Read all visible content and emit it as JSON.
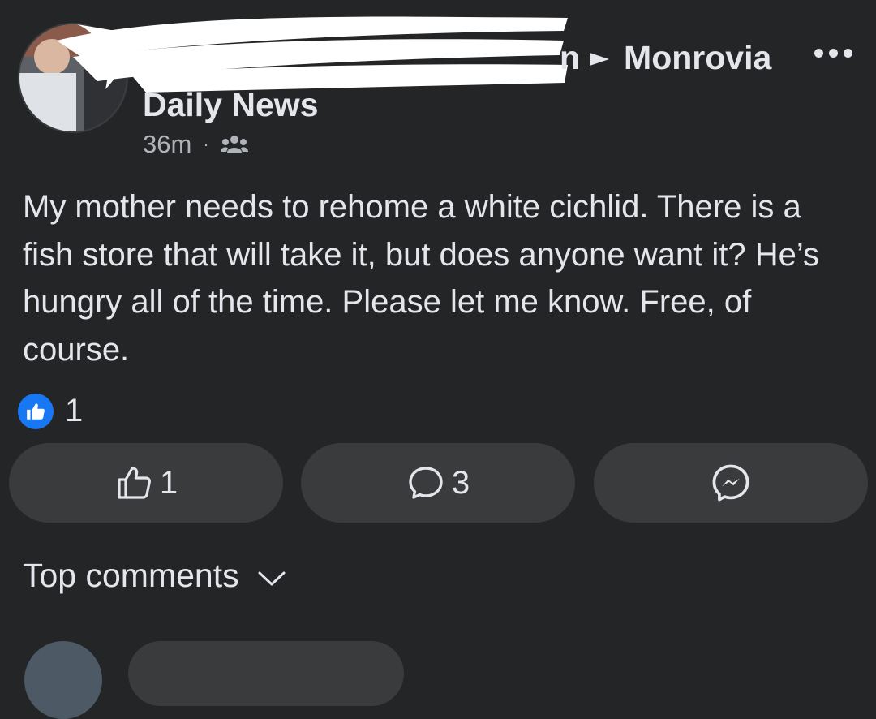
{
  "post": {
    "author_visible_tail": "n",
    "target": "Monrovia",
    "group_name": "Daily News",
    "timestamp": "36m",
    "dot": "·",
    "body": "My mother needs to rehome a white cichlid. There is a fish store that will take it, but does anyone want it? He’s hungry all of the time. Please let me know. Free, of course."
  },
  "reactions": {
    "count": "1"
  },
  "actions": {
    "like_count": "1",
    "comment_count": "3"
  },
  "comments": {
    "sort_label": "Top comments"
  },
  "colors": {
    "background": "#242526",
    "button": "#3a3b3c",
    "like_blue": "#1877f2",
    "text": "#e4e6eb",
    "secondary_text": "#b0b3b8"
  },
  "icons": {
    "audience": "group-icon",
    "more": "more-icon",
    "reaction": "like-reaction-icon",
    "like": "thumbs-up-icon",
    "comment": "comment-icon",
    "send": "messenger-icon",
    "sort": "chevron-down-icon"
  }
}
